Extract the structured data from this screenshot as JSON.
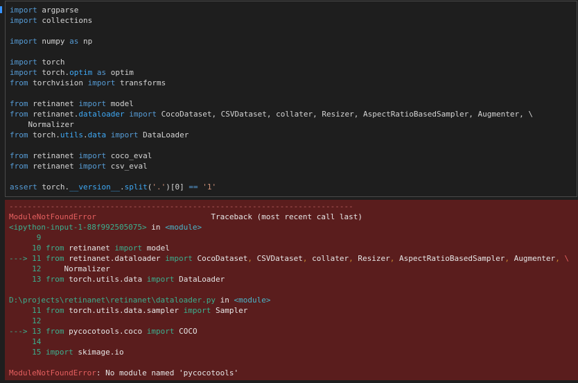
{
  "code": {
    "lines": {
      "l1": {
        "kw": "import",
        "rest": " argparse"
      },
      "l2": {
        "kw": "import",
        "rest": " collections"
      },
      "l4": {
        "kw": "import",
        "mod": " numpy ",
        "as": "as",
        "alias": " np"
      },
      "l6": {
        "kw": "import",
        "rest": " torch"
      },
      "l7": {
        "kw": "import",
        "mod": " torch.",
        "attr": "optim",
        "sp": " ",
        "as": "as",
        "alias": " optim"
      },
      "l8": {
        "kw": "from",
        "mod": " torchvision ",
        "imp": "import",
        "rest": " transforms"
      },
      "l10": {
        "kw": "from",
        "mod": " retinanet ",
        "imp": "import",
        "rest": " model"
      },
      "l11": {
        "kw": "from",
        "mod": " retinanet.",
        "attr": "dataloader",
        "sp": " ",
        "imp": "import",
        "rest": " CocoDataset, CSVDataset, collater, Resizer, AspectRatioBasedSampler, Augmenter, \\"
      },
      "l12": {
        "rest": "    Normalizer"
      },
      "l13": {
        "kw": "from",
        "mod": " torch.",
        "attr": "utils",
        "dot": ".",
        "attr2": "data",
        "sp": " ",
        "imp": "import",
        "rest": " DataLoader"
      },
      "l15": {
        "kw": "from",
        "mod": " retinanet ",
        "imp": "import",
        "rest": " coco_eval"
      },
      "l16": {
        "kw": "from",
        "mod": " retinanet ",
        "imp": "import",
        "rest": " csv_eval"
      },
      "l18": {
        "kw": "assert",
        "mod": " torch.",
        "dunder": "__version__",
        "dot": ".",
        "attr": "split",
        "p1": "(",
        "str1": "'.'",
        "p2": ")[0] ",
        "eq": "==",
        "sp": " ",
        "str2": "'1'"
      }
    }
  },
  "traceback": {
    "dashes": "---------------------------------------------------------------------------",
    "error_name": "ModuleNotFoundError",
    "header": "                         Traceback (most recent call last)",
    "input_ref": "<ipython-input-1-88f992505075>",
    "in_word": " in ",
    "module_tag": "<module>",
    "frame1": {
      "l9": "      9",
      "l10_num": "     10",
      "l10_from": " from",
      "l10_mod": " retinanet ",
      "l10_imp": "import",
      "l10_rest": " model",
      "arrow": "---> 11",
      "l11_from": " from",
      "l11_mod": " retinanet.dataloader ",
      "l11_imp": "import",
      "l11_a": " CocoDataset",
      "l11_b": " CSVDataset",
      "l11_c": " collater",
      "l11_d": " Resizer",
      "l11_e": " AspectRatioBasedSampler",
      "l11_f": " Augmenter",
      "comma": ",",
      "backslash": " \\",
      "l12_num": "     12",
      "l12_rest": "     Normalizer",
      "l13_num": "     13",
      "l13_from": " from",
      "l13_mod": " torch.utils.data ",
      "l13_imp": "import",
      "l13_rest": " DataLoader"
    },
    "file_path": "D:\\projects\\retinanet\\retinanet\\dataloader.py",
    "frame2": {
      "l11_num": "     11",
      "l11_from": " from",
      "l11_mod": " torch.utils.data.sampler ",
      "l11_imp": "import",
      "l11_rest": " Sampler",
      "l12_num": "     12",
      "arrow": "---> 13",
      "l13_from": " from",
      "l13_mod": " pycocotools.coco ",
      "l13_imp": "import",
      "l13_rest": " COCO",
      "l14_num": "     14",
      "l15_num": "     15",
      "l15_imp": " import",
      "l15_rest": " skimage.io"
    },
    "final_error": "ModuleNotFoundError",
    "final_msg": ": No module named 'pycocotools'"
  }
}
